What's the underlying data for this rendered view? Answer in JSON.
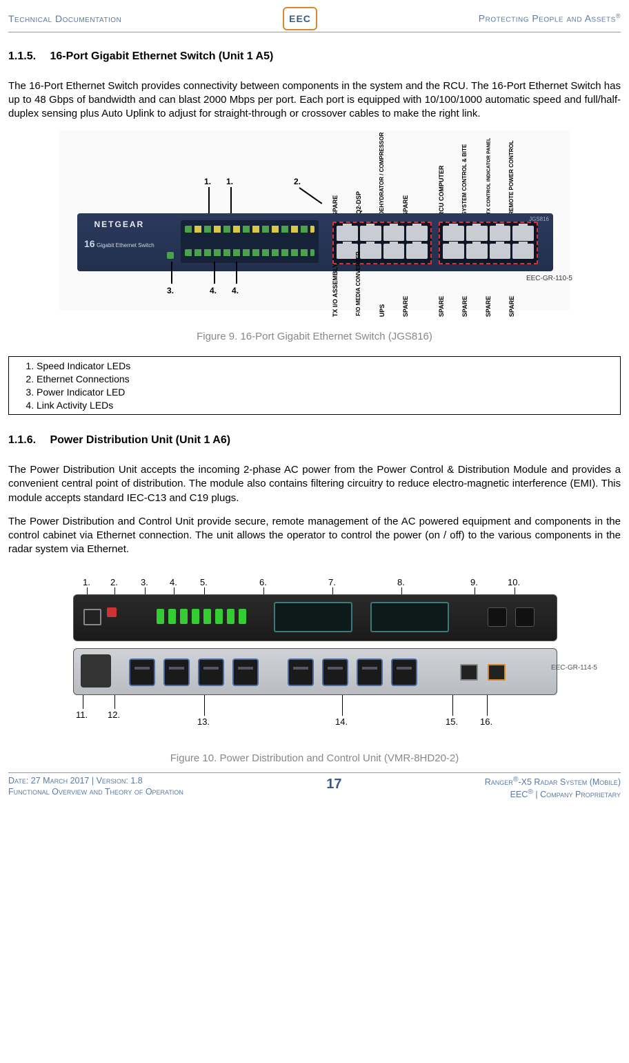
{
  "header": {
    "left": "Technical Documentation",
    "right_pre": "Protecting People and Assets",
    "right_sup": "®",
    "logo": "EEC"
  },
  "section1": {
    "num": "1.1.5.",
    "title": "16-Port Gigabit Ethernet Switch (Unit 1 A5)",
    "para": "The 16-Port Ethernet Switch provides connectivity between components in the system and the RCU.  The 16-Port Ethernet Switch has up to 48 Gbps of bandwidth and can blast 2000 Mbps per port.  Each port is equipped with 10/100/1000 automatic speed and full/half-duplex sensing plus Auto Uplink to adjust for straight-through or crossover cables to make the right link."
  },
  "switch_fig": {
    "brand": "NETGEAR",
    "subbrand_a": "16",
    "subbrand_b": "Gigabit Ethernet Switch",
    "model_tag": "JGS816",
    "part_tag": "EEC-GR-110-5",
    "callouts": {
      "c1a": "1.",
      "c1b": "1.",
      "c2": "2.",
      "c3": "3.",
      "c4a": "4.",
      "c4b": "4."
    },
    "vlabels_top": [
      "SPARE",
      "IQ2-DSP",
      "DEHYDRATOR / COMPRESSOR",
      "SPARE",
      "RCU COMPUTER",
      "SYSTEM CONTROL & BITE",
      "TX CONTROL INDICATOR PANEL",
      "REMOTE POWER CONTROL"
    ],
    "vlabels_bot": [
      "TX I/O ASSEMBLY",
      "F/O MEDIA CONVERTER",
      "UPS",
      "SPARE",
      "SPARE",
      "SPARE",
      "SPARE",
      "SPARE"
    ],
    "caption": "Figure 9. 16-Port Gigabit Ethernet Switch (JGS816)"
  },
  "legend": [
    "Speed Indicator LEDs",
    "Ethernet Connections",
    "Power Indicator LED",
    "Link Activity LEDs"
  ],
  "section2": {
    "num": "1.1.6.",
    "title": "Power Distribution Unit (Unit 1 A6)",
    "para1": "The Power Distribution Unit accepts the incoming 2-phase AC power from the Power Control & Distribution Module and provides a convenient central point of distribution.  The module also contains filtering circuitry to reduce electro-magnetic interference (EMI).  This module accepts standard IEC-C13 and C19 plugs.",
    "para2": "The Power Distribution and Control Unit provide secure, remote management of the AC powered equipment and components in the control cabinet via Ethernet connection.  The unit allows the operator to control the power (on / off) to the various components in the radar system via Ethernet."
  },
  "pdu_fig": {
    "part_tag": "EEC-GR-114-5",
    "callouts_top": [
      "1.",
      "2.",
      "3.",
      "4.",
      "5.",
      "6.",
      "7.",
      "8.",
      "9.",
      "10."
    ],
    "callouts_bot": [
      "11.",
      "12.",
      "13.",
      "14.",
      "15.",
      "16."
    ],
    "caption": "Figure 10. Power Distribution and Control Unit (VMR-8HD20-2)"
  },
  "footer": {
    "left1": "Date: 27 March 2017 | Version: 1.8",
    "left2": "Functional Overview and Theory of Operation",
    "page": "17",
    "right1_a": "Ranger",
    "right1_b": "®",
    "right1_c": "-X5 Radar System (Mobile)",
    "right2_a": "EEC",
    "right2_b": "®",
    "right2_c": " | Company Proprietary"
  }
}
